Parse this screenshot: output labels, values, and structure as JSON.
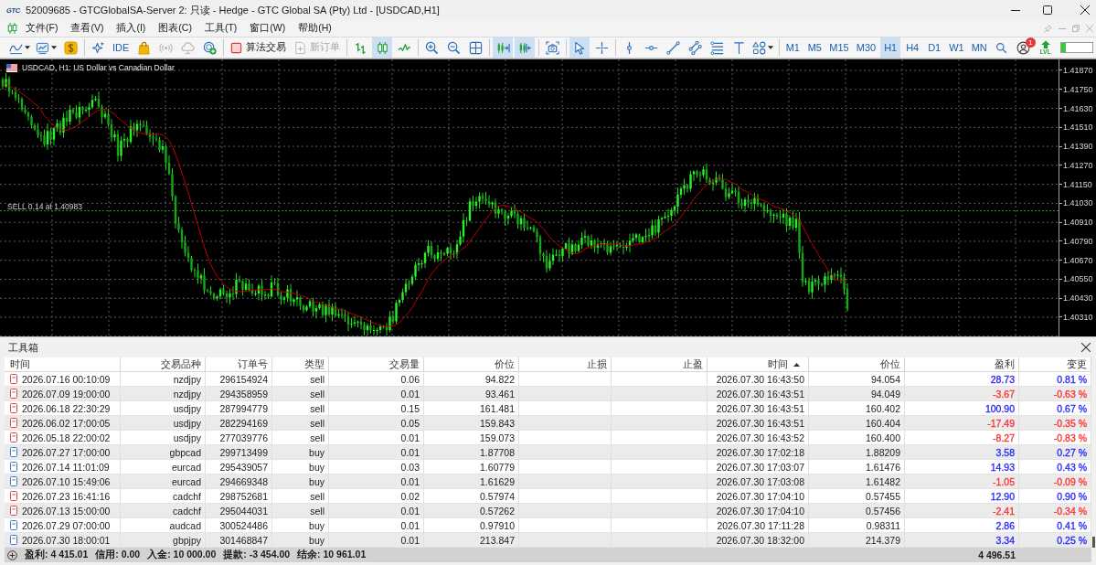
{
  "window": {
    "logo": "GTC",
    "title": "52009685 - GTCGlobalSA-Server 2: 只读 - Hedge - GTC Global SA (Pty) Ltd - [USDCAD,H1]"
  },
  "menu": {
    "items": [
      "文件(F)",
      "查看(V)",
      "插入(I)",
      "图表(C)",
      "工具(T)",
      "窗口(W)",
      "帮助(H)"
    ]
  },
  "toolbar": {
    "groups": [
      [
        {
          "kind": "dropdown",
          "selected": false,
          "disabled": false
        },
        {
          "kind": "dropdown",
          "selected": false,
          "disabled": false
        },
        {
          "kind": "icon",
          "selected": false,
          "disabled": false
        }
      ],
      [
        {
          "kind": "icon",
          "selected": false,
          "disabled": false
        },
        {
          "kind": "text",
          "label": "IDE",
          "selected": false,
          "disabled": false
        },
        {
          "kind": "icon",
          "selected": false,
          "disabled": false
        },
        {
          "kind": "icon",
          "selected": false,
          "disabled": true
        },
        {
          "kind": "icon",
          "selected": false,
          "disabled": true
        },
        {
          "kind": "icon",
          "selected": false,
          "disabled": false
        }
      ],
      [
        {
          "kind": "icon-text",
          "label": "算法交易",
          "selected": false,
          "disabled": false
        },
        {
          "kind": "icon-text",
          "label": "新订单",
          "selected": false,
          "disabled": true
        }
      ],
      [
        {
          "kind": "icon",
          "selected": false,
          "disabled": false
        },
        {
          "kind": "icon",
          "selected": true,
          "disabled": false
        },
        {
          "kind": "icon",
          "selected": false,
          "disabled": false
        }
      ],
      [
        {
          "kind": "icon",
          "selected": false,
          "disabled": false
        },
        {
          "kind": "icon",
          "selected": false,
          "disabled": false
        },
        {
          "kind": "icon",
          "selected": false,
          "disabled": false
        }
      ],
      [
        {
          "kind": "icon",
          "selected": true,
          "disabled": false
        },
        {
          "kind": "icon",
          "selected": true,
          "disabled": false
        }
      ],
      [
        {
          "kind": "icon",
          "selected": false,
          "disabled": false
        }
      ],
      [
        {
          "kind": "icon",
          "selected": true,
          "disabled": false
        },
        {
          "kind": "icon",
          "selected": false,
          "disabled": false
        }
      ],
      [
        {
          "kind": "icon",
          "selected": false,
          "disabled": false
        },
        {
          "kind": "icon",
          "selected": false,
          "disabled": false
        },
        {
          "kind": "icon",
          "selected": false,
          "disabled": false
        },
        {
          "kind": "icon",
          "selected": false,
          "disabled": false
        },
        {
          "kind": "icon",
          "selected": false,
          "disabled": false
        },
        {
          "kind": "icon",
          "selected": false,
          "disabled": false
        },
        {
          "kind": "dropdown",
          "selected": false,
          "disabled": false
        }
      ],
      [
        {
          "kind": "text",
          "label": "M1",
          "selected": false,
          "disabled": false
        },
        {
          "kind": "text",
          "label": "M5",
          "selected": false,
          "disabled": false
        },
        {
          "kind": "text",
          "label": "M15",
          "selected": false,
          "disabled": false
        },
        {
          "kind": "text",
          "label": "M30",
          "selected": false,
          "disabled": false
        },
        {
          "kind": "text",
          "label": "H1",
          "selected": true,
          "disabled": false
        },
        {
          "kind": "text",
          "label": "H4",
          "selected": false,
          "disabled": false
        },
        {
          "kind": "text",
          "label": "D1",
          "selected": false,
          "disabled": false
        },
        {
          "kind": "text",
          "label": "W1",
          "selected": false,
          "disabled": false
        },
        {
          "kind": "text",
          "label": "MN",
          "selected": false,
          "disabled": false
        },
        {
          "kind": "icon",
          "selected": false,
          "disabled": false
        },
        {
          "kind": "badge",
          "badge": "1",
          "selected": false,
          "disabled": false
        },
        {
          "kind": "stacked",
          "label": "LVL",
          "selected": false,
          "disabled": false
        },
        {
          "kind": "meter",
          "level": 0.15
        }
      ]
    ]
  },
  "chart": {
    "symbol_label": "USDCAD, H1: US Dollar vs Canadian Dollar",
    "order_label": "SELL 0.14 at 1.40983",
    "price_axis": [
      "1.41870",
      "1.41750",
      "1.41630",
      "1.41510",
      "1.41390",
      "1.41270",
      "1.41150",
      "1.41030",
      "1.40910",
      "1.40790",
      "1.40670",
      "1.40550",
      "1.40430",
      "1.40310"
    ]
  },
  "toolbox": {
    "title": "工具箱",
    "columns": [
      {
        "label": "时间",
        "sorted": false
      },
      {
        "label": "交易品种",
        "sorted": false
      },
      {
        "label": "订单号",
        "sorted": false
      },
      {
        "label": "类型",
        "sorted": false
      },
      {
        "label": "交易量",
        "sorted": false
      },
      {
        "label": "价位",
        "sorted": false
      },
      {
        "label": "止损",
        "sorted": false
      },
      {
        "label": "止盈",
        "sorted": false
      },
      {
        "label": "时间",
        "sorted": true
      },
      {
        "label": "价位",
        "sorted": false
      },
      {
        "label": "盈利",
        "sorted": false
      },
      {
        "label": "变更",
        "sorted": false
      }
    ],
    "rows": [
      {
        "kind": "sell",
        "time": "2026.07.16 00:10:09",
        "symbol": "nzdjpy",
        "ticket": "296154924",
        "type": "sell",
        "volume": "0.06",
        "price": "94.822",
        "close_time": "2026.07.30 16:43:50",
        "close_price": "94.054",
        "profit": "28.73",
        "change": "0.81 %",
        "color": "#2424ff"
      },
      {
        "kind": "sell",
        "time": "2026.07.09 19:00:00",
        "symbol": "nzdjpy",
        "ticket": "294358959",
        "type": "sell",
        "volume": "0.01",
        "price": "93.461",
        "close_time": "2026.07.30 16:43:51",
        "close_price": "94.049",
        "profit": "-3.67",
        "change": "-0.63 %",
        "color": "#ff2d2d"
      },
      {
        "kind": "sell",
        "time": "2026.06.18 22:30:29",
        "symbol": "usdjpy",
        "ticket": "287994779",
        "type": "sell",
        "volume": "0.15",
        "price": "161.481",
        "close_time": "2026.07.30 16:43:51",
        "close_price": "160.402",
        "profit": "100.90",
        "change": "0.67 %",
        "color": "#2424ff"
      },
      {
        "kind": "sell",
        "time": "2026.06.02 17:00:05",
        "symbol": "usdjpy",
        "ticket": "282294169",
        "type": "sell",
        "volume": "0.05",
        "price": "159.843",
        "close_time": "2026.07.30 16:43:51",
        "close_price": "160.404",
        "profit": "-17.49",
        "change": "-0.35 %",
        "color": "#ff2d2d"
      },
      {
        "kind": "sell",
        "time": "2026.05.18 22:00:02",
        "symbol": "usdjpy",
        "ticket": "277039776",
        "type": "sell",
        "volume": "0.01",
        "price": "159.073",
        "close_time": "2026.07.30 16:43:52",
        "close_price": "160.400",
        "profit": "-8.27",
        "change": "-0.83 %",
        "color": "#ff2d2d"
      },
      {
        "kind": "buy",
        "time": "2026.07.27 17:00:00",
        "symbol": "gbpcad",
        "ticket": "299713499",
        "type": "buy",
        "volume": "0.01",
        "price": "1.87708",
        "close_time": "2026.07.30 17:02:18",
        "close_price": "1.88209",
        "profit": "3.58",
        "change": "0.27 %",
        "color": "#2424ff"
      },
      {
        "kind": "buy",
        "time": "2026.07.14 11:01:09",
        "symbol": "eurcad",
        "ticket": "295439057",
        "type": "buy",
        "volume": "0.03",
        "price": "1.60779",
        "close_time": "2026.07.30 17:03:07",
        "close_price": "1.61476",
        "profit": "14.93",
        "change": "0.43 %",
        "color": "#2424ff"
      },
      {
        "kind": "buy",
        "time": "2026.07.10 15:49:06",
        "symbol": "eurcad",
        "ticket": "294669348",
        "type": "buy",
        "volume": "0.01",
        "price": "1.61629",
        "close_time": "2026.07.30 17:03:08",
        "close_price": "1.61482",
        "profit": "-1.05",
        "change": "-0.09 %",
        "color": "#ff2d2d"
      },
      {
        "kind": "sell",
        "time": "2026.07.23 16:41:16",
        "symbol": "cadchf",
        "ticket": "298752681",
        "type": "sell",
        "volume": "0.02",
        "price": "0.57974",
        "close_time": "2026.07.30 17:04:10",
        "close_price": "0.57455",
        "profit": "12.90",
        "change": "0.90 %",
        "color": "#2424ff"
      },
      {
        "kind": "sell",
        "time": "2026.07.13 15:00:00",
        "symbol": "cadchf",
        "ticket": "295044031",
        "type": "sell",
        "volume": "0.01",
        "price": "0.57262",
        "close_time": "2026.07.30 17:04:10",
        "close_price": "0.57456",
        "profit": "-2.41",
        "change": "-0.34 %",
        "color": "#ff2d2d"
      },
      {
        "kind": "buy",
        "time": "2026.07.29 07:00:00",
        "symbol": "audcad",
        "ticket": "300524486",
        "type": "buy",
        "volume": "0.01",
        "price": "0.97910",
        "close_time": "2026.07.30 17:11:28",
        "close_price": "0.98311",
        "profit": "2.86",
        "change": "0.41 %",
        "color": "#2424ff"
      },
      {
        "kind": "buy",
        "time": "2026.07.30 18:00:01",
        "symbol": "gbpjpy",
        "ticket": "301468847",
        "type": "buy",
        "volume": "0.01",
        "price": "213.847",
        "close_time": "2026.07.30 18:32:00",
        "close_price": "214.379",
        "profit": "3.34",
        "change": "0.25 %",
        "color": "#2424ff"
      }
    ],
    "summary": {
      "items": [
        "盈利: 4 415.01",
        "信用: 0.00",
        "入金: 10 000.00",
        "提款: -3 454.00",
        "结余: 10 961.01"
      ],
      "total": "4 496.51"
    }
  }
}
